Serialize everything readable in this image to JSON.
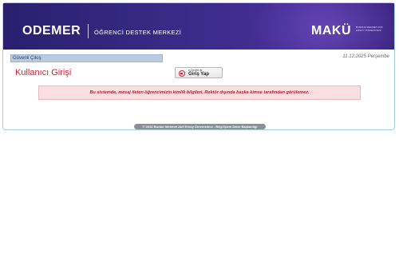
{
  "header": {
    "logo_text": "ODEMER",
    "subtitle": "ÖĞRENCİ DESTEK MERKEZİ",
    "university_logo": "MAKÜ",
    "university_sub": "BURDUR MEHMET AKİF ERSOY ÜNİVERSİTESİ"
  },
  "nav": {
    "logout_label": "Güvenli Çıkış",
    "date": "11.12.2025 Perşembe"
  },
  "main": {
    "title": "Kullanıcı Girişi",
    "edevlet_small": "e-Devlet ile",
    "edevlet_label": "Giriş Yap",
    "notice": "Bu sistemde, mesaj ileten öğrencimizin kimlik bilgileri, Rektör dışında başka kimse tarafından görülemez."
  },
  "footer": {
    "copyright": "© 2016 Burdur Mehmet Akif Ersoy Üniversitesi - Bilgi İşlem Daire Başkanlığı"
  },
  "colors": {
    "banner": "#3b2c8a",
    "accent_red": "#d02030",
    "nav_bar": "#b9cbe0",
    "notice_bg": "#fbdfe0"
  }
}
